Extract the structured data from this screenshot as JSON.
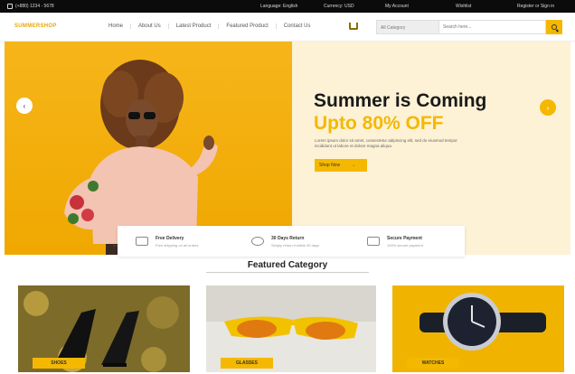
{
  "topbar": {
    "phone": "(+880) 1234 - 5678",
    "language": "Language: English",
    "currency": "Currency: USD",
    "account": "My Account",
    "wishlist": "Wishlist",
    "login": "Register or Sign in"
  },
  "nav": {
    "logo": "SUMMERSHOP",
    "menu": [
      "Home",
      "About Us",
      "Latest Product",
      "Featured Product",
      "Contact Us"
    ],
    "search": {
      "category": "All Category",
      "placeholder": "Search here..."
    }
  },
  "hero": {
    "title": "Summer is Coming",
    "subtitle": "Upto 80% OFF",
    "description": "Lorem ipsum dolor sit amet, consectetur adipiscing elit, sed do eiusmod tempor incididunt ut labore et dolore magna aliqua.",
    "button": "Shop Now",
    "button_arrow": "→",
    "prev": "‹",
    "next": "›"
  },
  "features": [
    {
      "title": "Free Delivery",
      "subtitle": "Free shipping on all orders"
    },
    {
      "title": "30 Days Return",
      "subtitle": "Simply return it within 30 days"
    },
    {
      "title": "Secure Payment",
      "subtitle": "100% secure payment"
    }
  ],
  "featured": {
    "title": "Featured Category",
    "cards": [
      {
        "label": "SHOES",
        "icon": "shoes-image"
      },
      {
        "label": "GLASSES",
        "icon": "sunglasses-image"
      },
      {
        "label": "WATCHES",
        "icon": "watch-image"
      }
    ]
  },
  "colors": {
    "accent": "#f5b800",
    "hero_right_bg": "#fdf2d6",
    "topbar_bg": "#0b0b0b"
  }
}
